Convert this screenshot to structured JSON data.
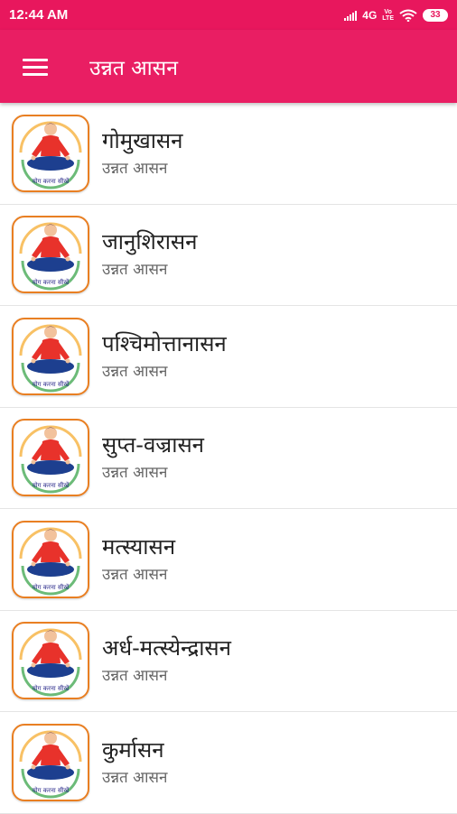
{
  "status_bar": {
    "time": "12:44 AM",
    "network": "4G",
    "volte": [
      "Vo",
      "LTE"
    ],
    "battery": "33",
    "icons": [
      "signal-icon",
      "wifi-icon",
      "battery-icon"
    ]
  },
  "app_bar": {
    "title": "उन्नत आसन",
    "menu_icon": "menu-icon",
    "background": "#e91e63"
  },
  "list": {
    "items": [
      {
        "title": "गोमुखासन",
        "subtitle": "उन्नत आसन"
      },
      {
        "title": "जानुशिरासन",
        "subtitle": "उन्नत आसन"
      },
      {
        "title": "पश्चिमोत्तानासन",
        "subtitle": "उन्नत आसन"
      },
      {
        "title": "सुप्त-वज्रासन",
        "subtitle": "उन्नत आसन"
      },
      {
        "title": "मत्स्यासन",
        "subtitle": "उन्नत आसन"
      },
      {
        "title": "अर्ध-मत्स्येन्द्रासन",
        "subtitle": "उन्नत आसन"
      },
      {
        "title": "कुर्मासन",
        "subtitle": "उन्नत आसन"
      }
    ],
    "thumbnail_icon": "yoga-logo-icon",
    "thumbnail_caption": "योग करना सीखें"
  }
}
